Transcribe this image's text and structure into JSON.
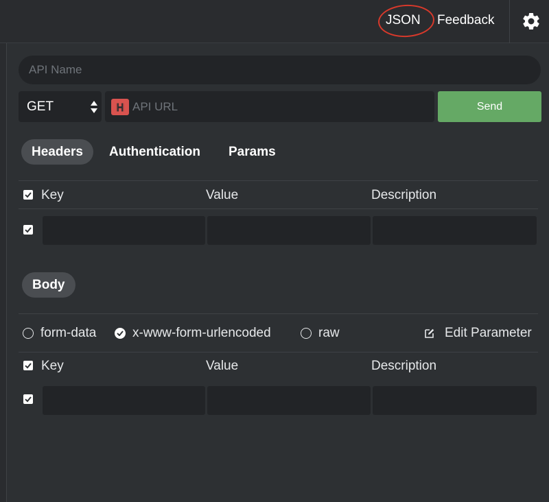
{
  "topbar": {
    "json_label": "JSON",
    "feedback_label": "Feedback"
  },
  "request": {
    "api_name_placeholder": "API Name",
    "method": "GET",
    "url_placeholder": "API URL",
    "send_label": "Send"
  },
  "tabs": [
    {
      "label": "Headers",
      "active": true
    },
    {
      "label": "Authentication",
      "active": false
    },
    {
      "label": "Params",
      "active": false
    }
  ],
  "headers_table": {
    "columns": [
      "Key",
      "Value",
      "Description"
    ]
  },
  "body": {
    "tab_label": "Body",
    "options": [
      {
        "label": "form-data",
        "selected": false
      },
      {
        "label": "x-www-form-urlencoded",
        "selected": true
      },
      {
        "label": "raw",
        "selected": false
      }
    ],
    "edit_parameter_label": "Edit Parameter",
    "columns": [
      "Key",
      "Value",
      "Description"
    ]
  },
  "colors": {
    "accent_send": "#65a965",
    "annotation_circle": "#d8392b",
    "badge": "#d9534f"
  }
}
